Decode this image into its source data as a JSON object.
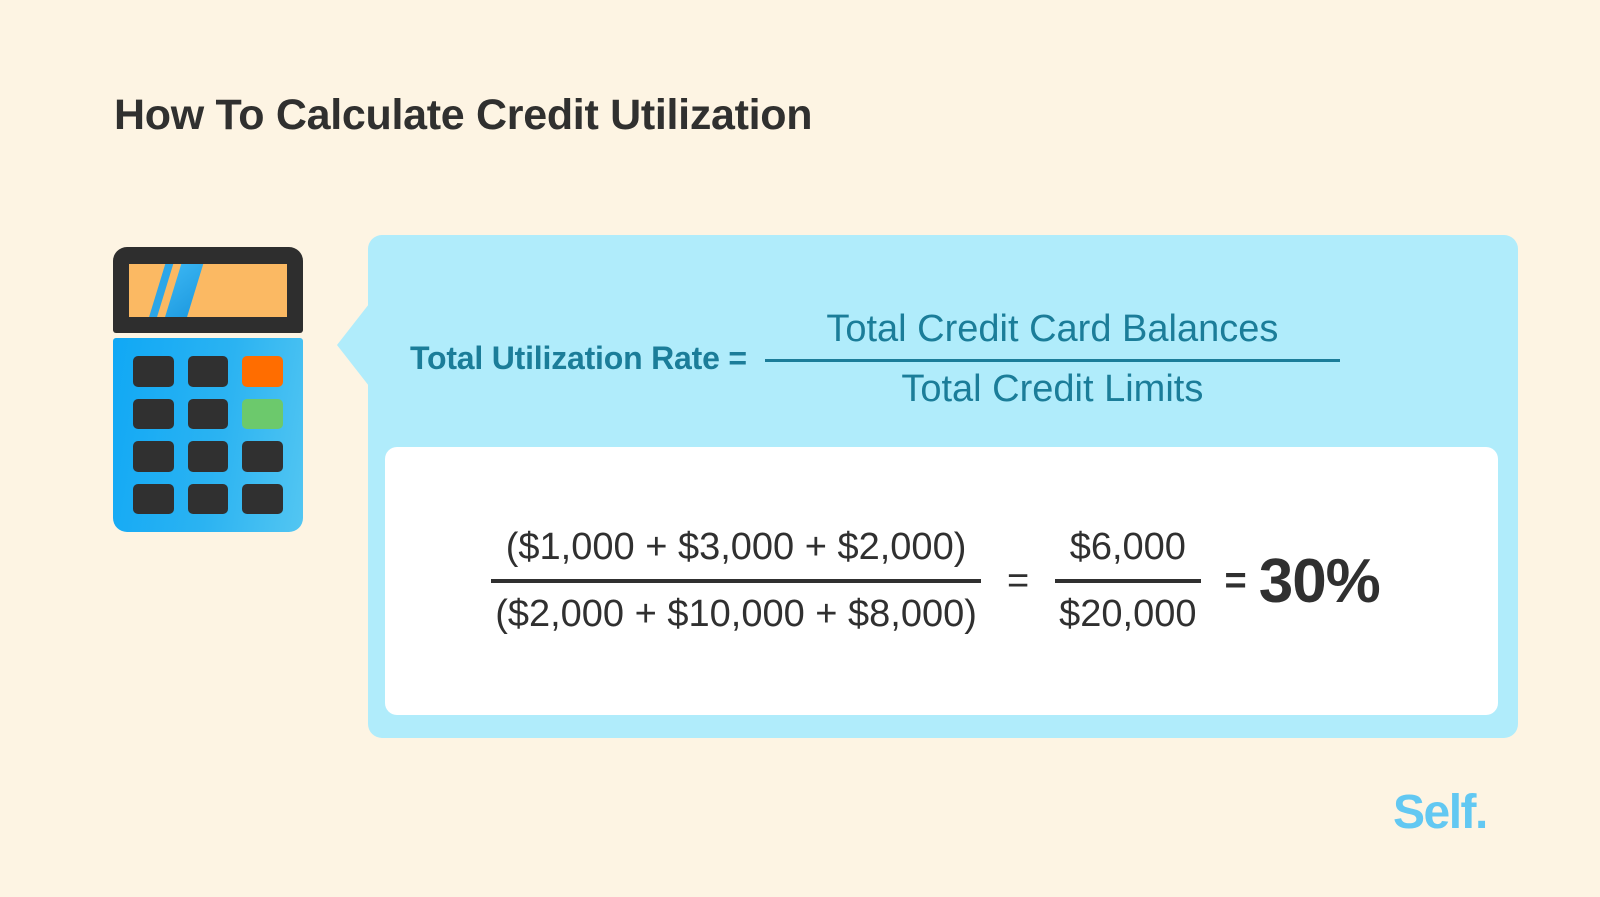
{
  "page": {
    "title": "How To Calculate Credit Utilization",
    "background_color": "#fdf4e3"
  },
  "colors": {
    "background": "#fdf4e3",
    "callout_background": "#b0ecfb",
    "card_background": "#ffffff",
    "teal_text": "#1b7d99",
    "dark_text": "#303030",
    "brand_blue": "#62c8f2",
    "calculator_body_blue": "#2bb3f2",
    "calculator_screen_orange": "#fbb963",
    "calculator_key_dark": "#303030",
    "calculator_key_orange": "#ff6d00",
    "calculator_key_green": "#6cc96c"
  },
  "illustration": {
    "name": "calculator",
    "screen_icon": "double-slash-icon",
    "keys": [
      {
        "row": 1,
        "col": 1,
        "color": "dark"
      },
      {
        "row": 1,
        "col": 2,
        "color": "dark"
      },
      {
        "row": 1,
        "col": 3,
        "color": "orange"
      },
      {
        "row": 2,
        "col": 1,
        "color": "dark"
      },
      {
        "row": 2,
        "col": 2,
        "color": "dark"
      },
      {
        "row": 2,
        "col": 3,
        "color": "green"
      },
      {
        "row": 3,
        "col": 1,
        "color": "dark"
      },
      {
        "row": 3,
        "col": 2,
        "color": "dark"
      },
      {
        "row": 3,
        "col": 3,
        "color": "dark"
      },
      {
        "row": 4,
        "col": 1,
        "color": "dark"
      },
      {
        "row": 4,
        "col": 2,
        "color": "dark"
      },
      {
        "row": 4,
        "col": 3,
        "color": "dark"
      }
    ]
  },
  "formula": {
    "label": "Total Utilization Rate =",
    "numerator": "Total Credit Card Balances",
    "denominator": "Total Credit Limits"
  },
  "calculation": {
    "expression_numerator": "($1,000 + $3,000 + $2,000)",
    "expression_denominator": "($2,000 + $10,000 + $8,000)",
    "equals_1": "=",
    "simplified_numerator": "$6,000",
    "simplified_denominator": "$20,000",
    "equals_2": "=",
    "result": "30%",
    "balances": [
      1000,
      3000,
      2000
    ],
    "limits": [
      2000,
      10000,
      8000
    ],
    "total_balances": 6000,
    "total_limits": 20000,
    "utilization_percent": 30
  },
  "brand": {
    "logo_text": "Self."
  }
}
